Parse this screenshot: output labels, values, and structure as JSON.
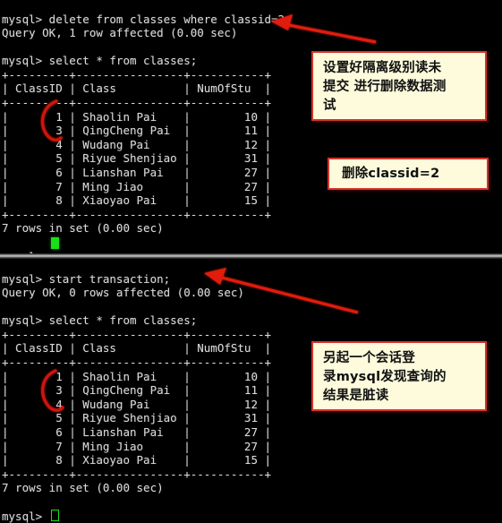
{
  "app": {
    "kind": "mysql-terminal",
    "prompt": "mysql>",
    "bg_color": "#000000",
    "text_color": "#d9d9d9",
    "cursor_color": "#19e019",
    "annotation_color": "#d4342a",
    "callout_fill": "#fdfbdc"
  },
  "panels": [
    {
      "id": "panel-top",
      "lines": [
        "mysql> delete from classes where classid=2;",
        "Query OK, 1 row affected (0.00 sec)",
        "",
        "mysql> select * from classes;",
        "+---------+----------------+-----------+",
        "| ClassID | Class          | NumOfStu  |",
        "+---------+----------------+-----------+",
        "|       1 | Shaolin Pai    |        10 |",
        "|       3 | QingCheng Pai  |        11 |",
        "|       4 | Wudang Pai     |        12 |",
        "|       5 | Riyue Shenjiao |        31 |",
        "|       6 | Lianshan Pai   |        27 |",
        "|       7 | Ming Jiao      |        27 |",
        "|       8 | Xiaoyao Pai    |        15 |",
        "+---------+----------------+-----------+",
        "7 rows in set (0.00 sec)",
        "",
        "mysql> "
      ]
    },
    {
      "id": "panel-bottom",
      "lines": [
        "mysql> start transaction;",
        "Query OK, 0 rows affected (0.00 sec)",
        "",
        "mysql> select * from classes;",
        "+---------+----------------+-----------+",
        "| ClassID | Class          | NumOfStu  |",
        "+---------+----------------+-----------+",
        "|       1 | Shaolin Pai    |        10 |",
        "|       3 | QingCheng Pai  |        11 |",
        "|       4 | Wudang Pai     |        12 |",
        "|       5 | Riyue Shenjiao |        31 |",
        "|       6 | Lianshan Pai   |        27 |",
        "|       7 | Ming Jiao      |        27 |",
        "|       8 | Xiaoyao Pai    |        15 |",
        "+---------+----------------+-----------+",
        "7 rows in set (0.00 sec)",
        "",
        "mysql> "
      ]
    }
  ],
  "result_table": {
    "headers": [
      "ClassID",
      "Class",
      "NumOfStu"
    ],
    "rows": [
      [
        "1",
        "Shaolin Pai",
        "10"
      ],
      [
        "3",
        "QingCheng Pai",
        "11"
      ],
      [
        "4",
        "Wudang Pai",
        "12"
      ],
      [
        "5",
        "Riyue Shenjiao",
        "31"
      ],
      [
        "6",
        "Lianshan Pai",
        "27"
      ],
      [
        "7",
        "Ming Jiao",
        "27"
      ],
      [
        "8",
        "Xiaoyao Pai",
        "15"
      ]
    ],
    "footer": "7 rows in set (0.00 sec)"
  },
  "commands": {
    "delete": "delete from classes where classid=2;",
    "delete_result": "Query OK, 1 row affected (0.00 sec)",
    "select": "select * from classes;",
    "start_transaction": "start transaction;",
    "start_transaction_result": "Query OK, 0 rows affected (0.00 sec)"
  },
  "callouts": [
    {
      "id": "callout-1",
      "lines": [
        "设置好隔离级别读未",
        "提交 进行删除数据测",
        "试"
      ]
    },
    {
      "id": "callout-2",
      "lines": [
        "删除classid=2"
      ]
    },
    {
      "id": "callout-3",
      "lines": [
        "另起一个会话登",
        "录mysql发现查询的",
        "结果是脏读"
      ]
    }
  ],
  "annotations": {
    "arrow_1_label": "points at delete result row",
    "arrow_2_label": "points at start transaction result row",
    "mark_1_label": "missing classid 2 gap marker (top table)",
    "mark_2_label": "missing classid 2 gap marker (bottom table)"
  }
}
